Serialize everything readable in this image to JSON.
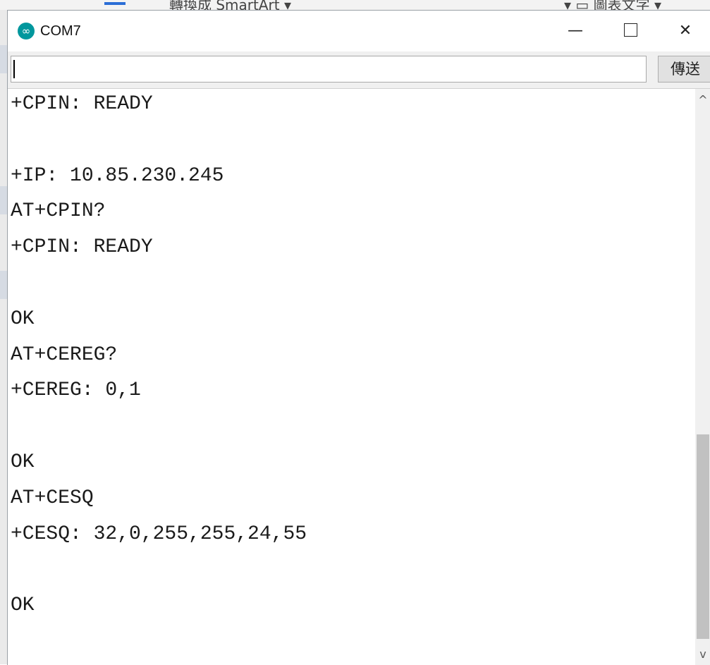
{
  "background_app": {
    "ribbon_text": "轉換成 SmartArt ▾",
    "ribbon_text_right": "▾   ▭ 圖表文字 ▾"
  },
  "window": {
    "title": "COM7",
    "icon": "arduino-icon",
    "controls": {
      "minimize": "—",
      "maximize": "maximize-icon",
      "close": "✕"
    }
  },
  "send_bar": {
    "input_value": "",
    "send_label": "傳送"
  },
  "output_lines": [
    "+CPIN: READY",
    "",
    "+IP: 10.85.230.245",
    "AT+CPIN?",
    "+CPIN: READY",
    "",
    "OK",
    "AT+CEREG?",
    "+CEREG: 0,1",
    "",
    "OK",
    "AT+CESQ",
    "+CESQ: 32,0,255,255,24,55",
    "",
    "OK"
  ],
  "scrollbar": {
    "up": "^",
    "down": "v",
    "position": 0.85
  }
}
